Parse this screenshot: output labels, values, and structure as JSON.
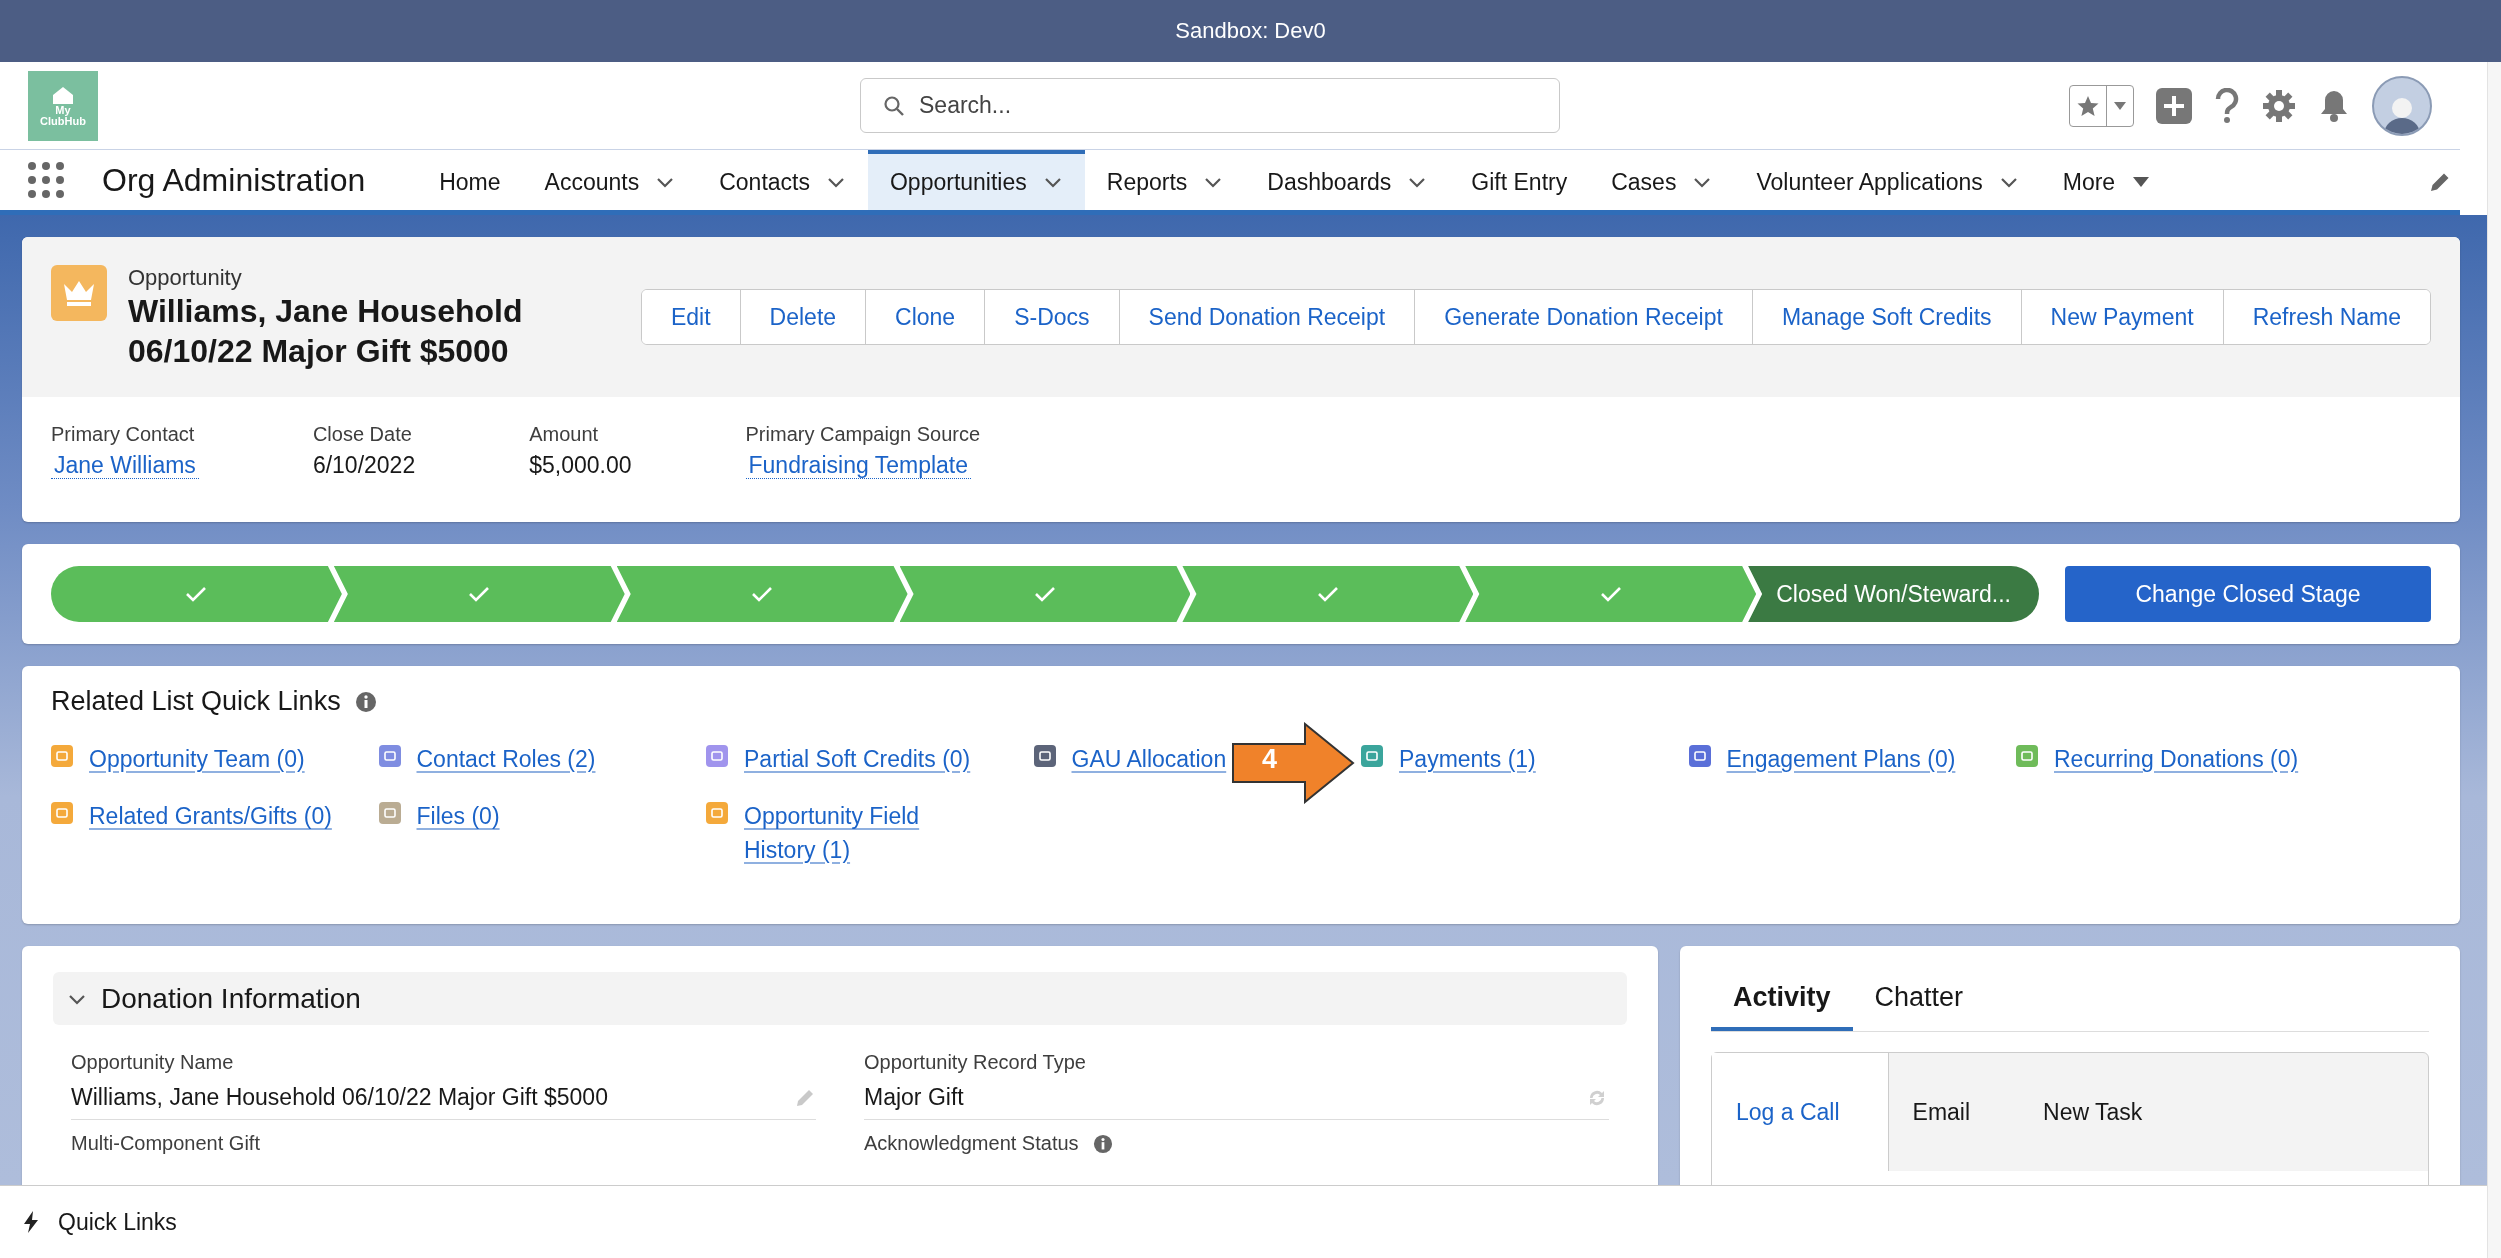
{
  "system_bar": {
    "title": "Sandbox: Dev0"
  },
  "header": {
    "logo": {
      "line_1": "My",
      "line_2": "ClubHub"
    },
    "search": {
      "placeholder": "Search..."
    }
  },
  "nav": {
    "app_name": "Org Administration",
    "items": [
      {
        "label": "Home",
        "selected": false,
        "kind": "plain"
      },
      {
        "label": "Accounts",
        "selected": false,
        "kind": "menu"
      },
      {
        "label": "Contacts",
        "selected": false,
        "kind": "menu"
      },
      {
        "label": "Opportunities",
        "selected": true,
        "kind": "menu"
      },
      {
        "label": "Reports",
        "selected": false,
        "kind": "menu"
      },
      {
        "label": "Dashboards",
        "selected": false,
        "kind": "menu"
      },
      {
        "label": "Gift Entry",
        "selected": false,
        "kind": "plain"
      },
      {
        "label": "Cases",
        "selected": false,
        "kind": "menu"
      },
      {
        "label": "Volunteer Applications",
        "selected": false,
        "kind": "menu"
      },
      {
        "label": "More",
        "selected": false,
        "kind": "more"
      }
    ]
  },
  "record": {
    "object_type": "Opportunity",
    "title_lines": [
      "Williams, Jane Household",
      "06/10/22 Major Gift $5000"
    ],
    "actions": [
      "Edit",
      "Delete",
      "Clone",
      "S-Docs",
      "Send Donation Receipt",
      "Generate Donation Receipt",
      "Manage Soft Credits",
      "New Payment",
      "Refresh Name"
    ],
    "highlights": [
      {
        "label": "Primary Contact",
        "value": "Jane Williams",
        "kind": "link"
      },
      {
        "label": "Close Date",
        "value": "6/10/2022",
        "kind": "text"
      },
      {
        "label": "Amount",
        "value": "$5,000.00",
        "kind": "text"
      },
      {
        "label": "Primary Campaign Source",
        "value": "Fundraising Template",
        "kind": "link"
      }
    ]
  },
  "path": {
    "stages": [
      {
        "kind": "complete"
      },
      {
        "kind": "complete"
      },
      {
        "kind": "complete"
      },
      {
        "kind": "complete"
      },
      {
        "kind": "complete"
      },
      {
        "kind": "complete"
      },
      {
        "kind": "current",
        "label": "Closed Won/Steward..."
      }
    ],
    "button": "Change Closed Stage"
  },
  "quick_links": {
    "title": "Related List Quick Links",
    "items": [
      {
        "label": "Opportunity Team (0)",
        "color": "#f4a93b"
      },
      {
        "label": "Contact Roles (2)",
        "color": "#7f8de1"
      },
      {
        "label": "Partial Soft Credits (0)",
        "color": "#a094ed"
      },
      {
        "label": "GAU Allocation",
        "color": "#5c6479"
      },
      {
        "label": "Payments (1)",
        "color": "#3ba59c"
      },
      {
        "label": "Engagement Plans (0)",
        "color": "#5a6fd8"
      },
      {
        "label": "Recurring Donations (0)",
        "color": "#6fbb5a"
      },
      {
        "label": "Related Grants/Gifts (0)",
        "color": "#f4a93b"
      },
      {
        "label": "Files (0)",
        "color": "#baac93"
      },
      {
        "label": "Opportunity Field History (1)",
        "color": "#f4a93b"
      }
    ]
  },
  "annotation": {
    "label": "4"
  },
  "donation_information": {
    "title": "Donation Information",
    "expanded": true,
    "fields": [
      {
        "label": "Opportunity Name",
        "value": "Williams, Jane Household 06/10/22 Major Gift $5000",
        "kind": "edit",
        "info": false
      },
      {
        "label": "Opportunity Record Type",
        "value": "Major Gift",
        "kind": "change",
        "info": false
      },
      {
        "label": "Multi-Component Gift",
        "info": false
      },
      {
        "label": "Acknowledgment Status",
        "info": true
      }
    ]
  },
  "activity": {
    "tabs": [
      {
        "label": "Activity",
        "selected": true
      },
      {
        "label": "Chatter",
        "selected": false
      }
    ],
    "composer_tabs": [
      {
        "label": "Log a Call",
        "selected": true
      },
      {
        "label": "Email",
        "selected": false
      },
      {
        "label": "New Task",
        "selected": false
      }
    ]
  },
  "utility_bar": {
    "label": "Quick Links"
  }
}
